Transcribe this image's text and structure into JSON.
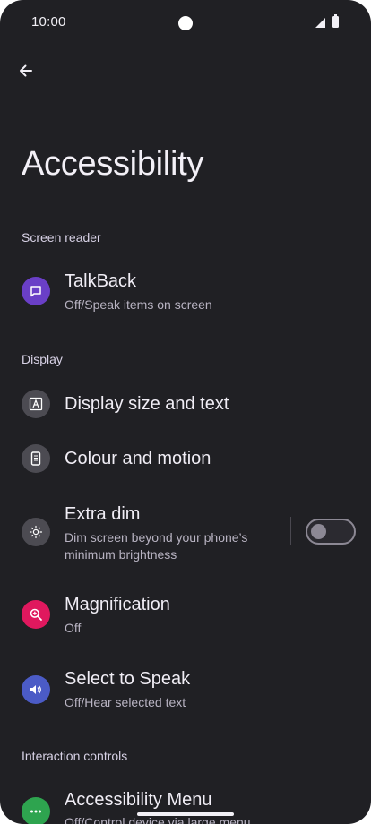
{
  "status_bar": {
    "time": "10:00"
  },
  "header": {
    "title": "Accessibility"
  },
  "sections": {
    "screen_reader": "Screen reader",
    "display": "Display",
    "interaction": "Interaction controls"
  },
  "items": {
    "talkback": {
      "title": "TalkBack",
      "subtitle": "Off/Speak items on screen",
      "icon_color": "#6a3fc7"
    },
    "display_size": {
      "title": "Display size and text",
      "icon_color": "#4c4b52"
    },
    "colour_motion": {
      "title": "Colour and motion",
      "icon_color": "#4c4b52"
    },
    "extra_dim": {
      "title": "Extra dim",
      "subtitle_line1": "Dim screen beyond your phone’s",
      "subtitle_line2": "minimum brightness",
      "icon_color": "#4c4b52",
      "toggle_on": false
    },
    "magnification": {
      "title": "Magnification",
      "subtitle": "Off",
      "icon_color": "#e0185e"
    },
    "select_to_speak": {
      "title": "Select to Speak",
      "subtitle": "Off/Hear selected text",
      "icon_color": "#4b5bc6"
    },
    "accessibility_menu": {
      "title": "Accessibility Menu",
      "subtitle": "Off/Control device via large menu",
      "icon_color": "#2ea44f"
    }
  }
}
